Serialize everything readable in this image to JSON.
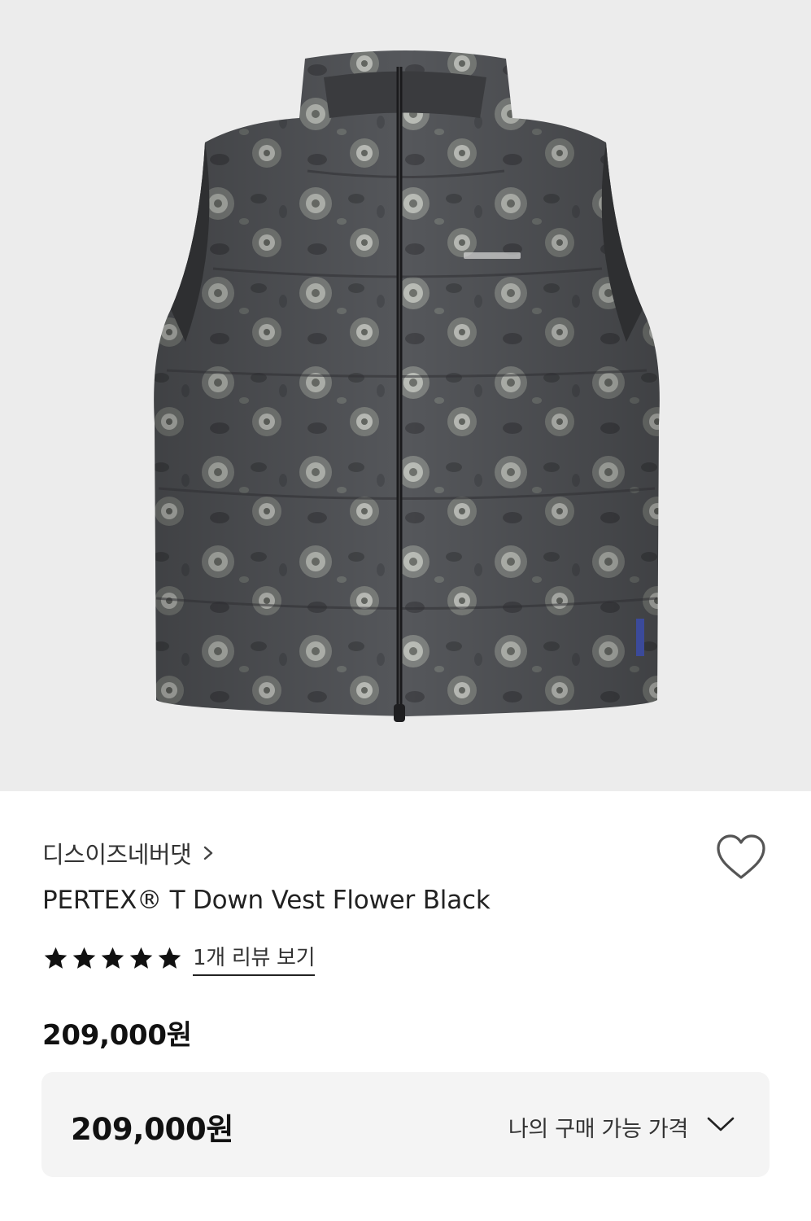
{
  "product_image": {
    "alt": "PERTEX® T Down Vest Flower Black",
    "background": "#ececec"
  },
  "brand": {
    "name": "디스이즈네버댓",
    "chevron_icon": "chevron-right-icon"
  },
  "wishlist": {
    "icon": "heart-outline-icon"
  },
  "product": {
    "name": "PERTEX® T Down Vest Flower Black",
    "rating_stars": 5,
    "review_link": "1개 리뷰 보기",
    "price": "209,000원"
  },
  "price_panel": {
    "value": "209,000원",
    "label": "나의 구매 가능 가격",
    "chevron_icon": "chevron-down-icon",
    "background": "#f4f4f4"
  }
}
